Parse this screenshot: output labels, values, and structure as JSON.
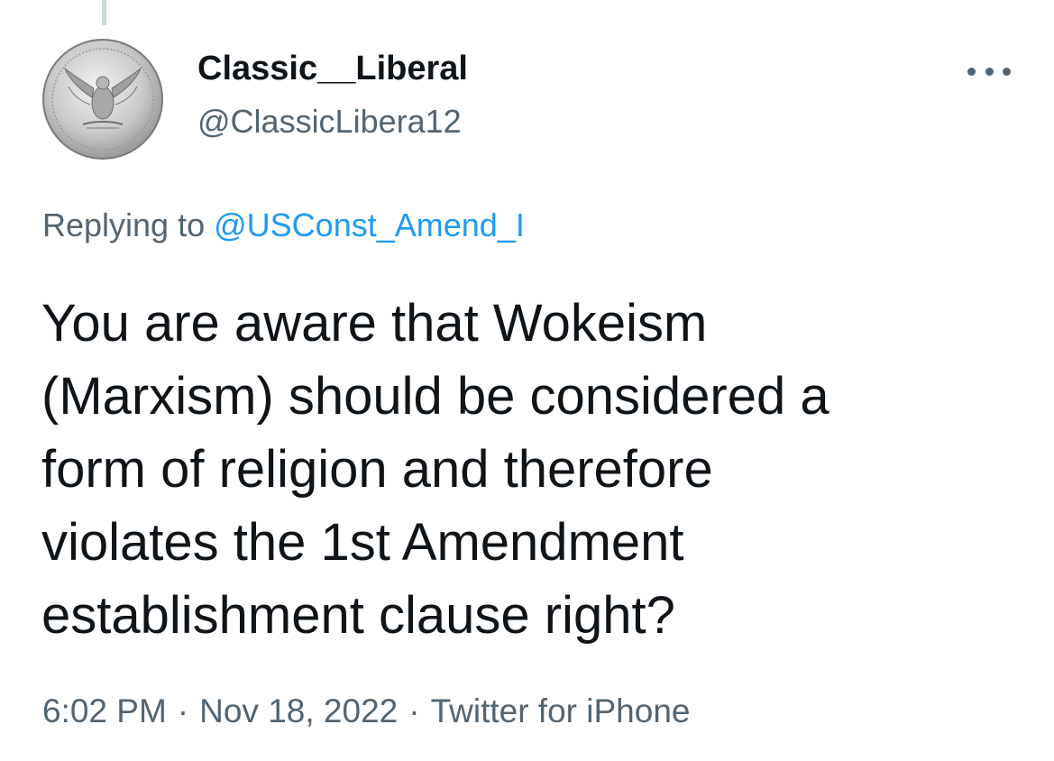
{
  "colors": {
    "text_primary": "#0f1419",
    "text_secondary": "#536471",
    "link": "#1d9bf0",
    "thread_line": "#cfd9de"
  },
  "author": {
    "display_name": "Classic__Liberal",
    "handle": "@ClassicLibera12",
    "avatar_icon": "quarter-coin-avatar"
  },
  "more_icon": "more-horizontal-icon",
  "reply": {
    "prefix": "Replying to",
    "mention": "@USConst_Amend_I"
  },
  "tweet": {
    "lines": [
      "You are aware that Wokeism",
      "(Marxism) should be considered a",
      "form of religion and therefore",
      "violates the 1st Amendment",
      "establishment clause right?"
    ]
  },
  "meta": {
    "time": "6:02 PM",
    "separator": "·",
    "date": "Nov 18, 2022",
    "source": "Twitter for iPhone"
  }
}
